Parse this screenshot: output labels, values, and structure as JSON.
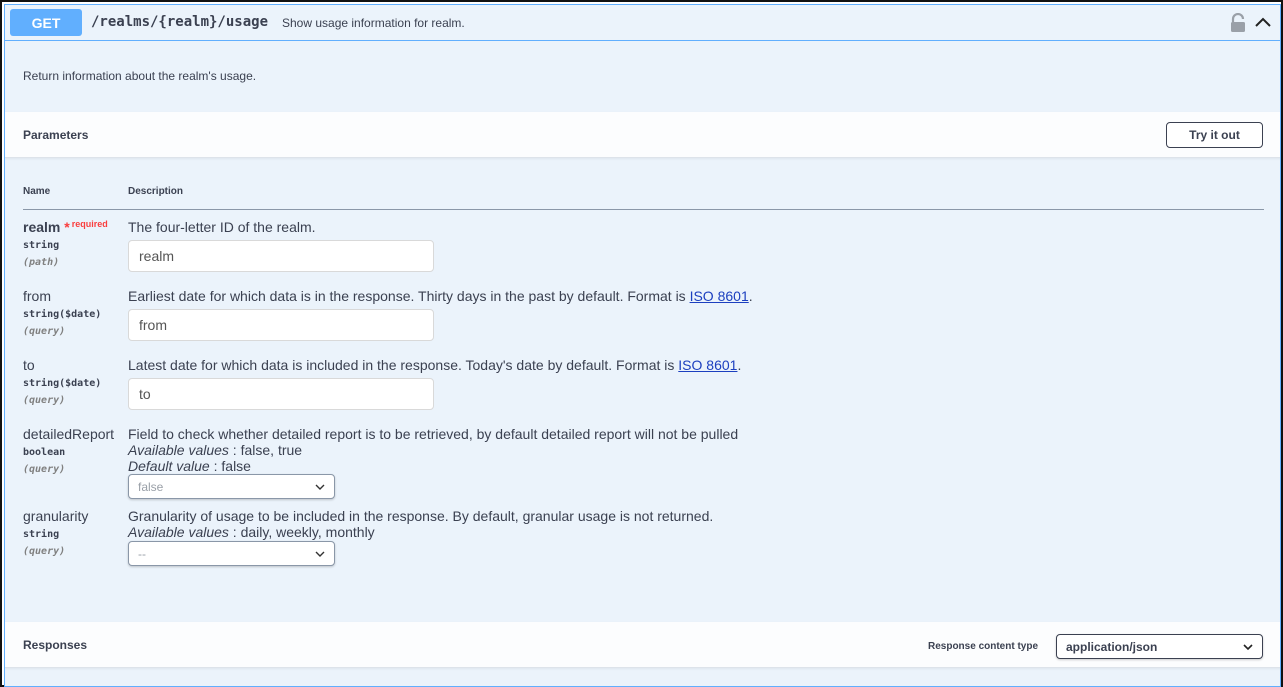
{
  "summary": {
    "method": "GET",
    "path": "/realms/{realm}/usage",
    "description": "Show usage information for realm.",
    "lock_icon": "lock-icon",
    "collapse_icon": "chevron-up-icon"
  },
  "operation": {
    "description": "Return information about the realm's usage."
  },
  "parameters": {
    "title": "Parameters",
    "try_label": "Try it out",
    "col_name": "Name",
    "col_description": "Description",
    "items": [
      {
        "name": "realm",
        "required_mark": "*",
        "required_label": "required",
        "type": "string",
        "in": "(path)",
        "description": "The four-letter ID of the realm.",
        "placeholder": "realm"
      },
      {
        "name": "from",
        "type": "string($date)",
        "in": "(query)",
        "description": "Earliest date for which data is in the response. Thirty days in the past by default. Format is ",
        "link": "ISO 8601",
        "suffix": ".",
        "placeholder": "from"
      },
      {
        "name": "to",
        "type": "string($date)",
        "in": "(query)",
        "description": "Latest date for which data is included in the response. Today's date by default. Format is ",
        "link": "ISO 8601",
        "suffix": ".",
        "placeholder": "to"
      },
      {
        "name": "detailedReport",
        "type": "boolean",
        "in": "(query)",
        "description": "Field to check whether detailed report is to be retrieved, by default detailed report will not be pulled",
        "available_label": "Available values",
        "available_values": " : false, true",
        "default_label": "Default value",
        "default_value": " : false",
        "selected": "false"
      },
      {
        "name": "granularity",
        "type": "string",
        "in": "(query)",
        "description": "Granularity of usage to be included in the response. By default, granular usage is not returned.",
        "available_label": "Available values",
        "available_values": " : daily, weekly, monthly",
        "selected": "--"
      }
    ]
  },
  "responses": {
    "title": "Responses",
    "content_type_label": "Response content type",
    "content_type": "application/json"
  },
  "colors": {
    "get_blue": "#61affe",
    "panel_bg": "#ebf3fb",
    "required_red": "#f93e3e",
    "link_blue": "#1c3fbf"
  }
}
